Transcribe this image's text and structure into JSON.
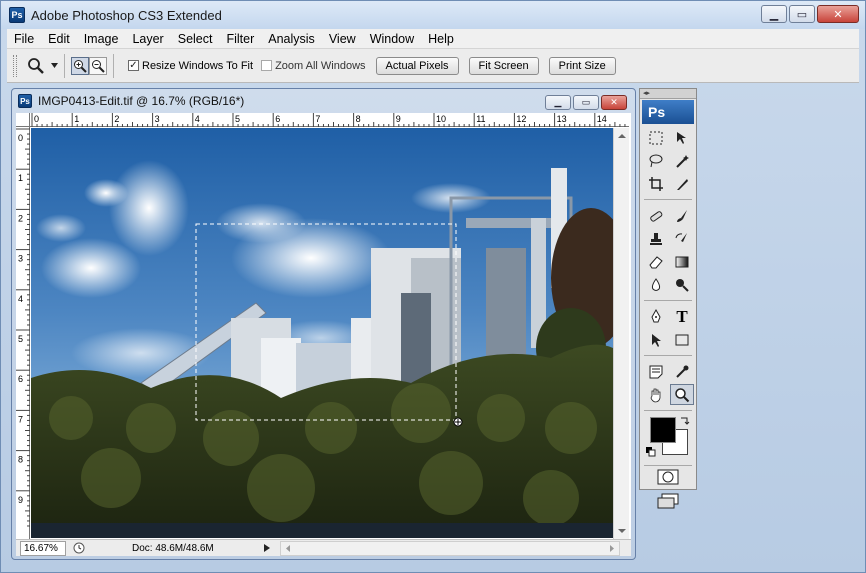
{
  "app": {
    "title": "Adobe Photoshop CS3 Extended",
    "logo": "Ps"
  },
  "menu": [
    {
      "label": "File",
      "u": "F",
      "rest": "ile"
    },
    {
      "label": "Edit",
      "u": "E",
      "rest": "dit"
    },
    {
      "label": "Image",
      "u": "I",
      "rest": "mage"
    },
    {
      "label": "Layer",
      "u": "L",
      "rest": "ayer"
    },
    {
      "label": "Select",
      "u": "S",
      "rest": "elect"
    },
    {
      "label": "Filter",
      "u": "",
      "rest": "Filter",
      "pre": "Fil",
      "mid": "t",
      "post": "er"
    },
    {
      "label": "Analysis",
      "u": "A",
      "rest": "nalysis"
    },
    {
      "label": "View",
      "u": "V",
      "rest": "iew"
    },
    {
      "label": "Window",
      "u": "W",
      "rest": "indow"
    },
    {
      "label": "Help",
      "u": "H",
      "rest": "elp"
    }
  ],
  "options": {
    "resize_windows": "Resize Windows To Fit",
    "zoom_all": "Zoom All Windows",
    "actual_pixels": "Actual Pixels",
    "fit_screen": "Fit Screen",
    "print_size": "Print Size",
    "check_mark": "✓"
  },
  "document": {
    "title": "IMGP0413-Edit.tif @ 16.7% (RGB/16*)",
    "zoom": "16.67%",
    "doc_size": "Doc: 48.6M/48.6M",
    "ruler_top": [
      "0",
      "1",
      "2",
      "3",
      "4",
      "5",
      "6",
      "7",
      "8",
      "9",
      "10",
      "11",
      "12",
      "13",
      "14"
    ],
    "ruler_left": [
      "0",
      "1",
      "2",
      "3",
      "4",
      "5",
      "6",
      "7",
      "8",
      "9"
    ]
  },
  "tools": {
    "logo": "Ps",
    "type_tool": "T"
  }
}
